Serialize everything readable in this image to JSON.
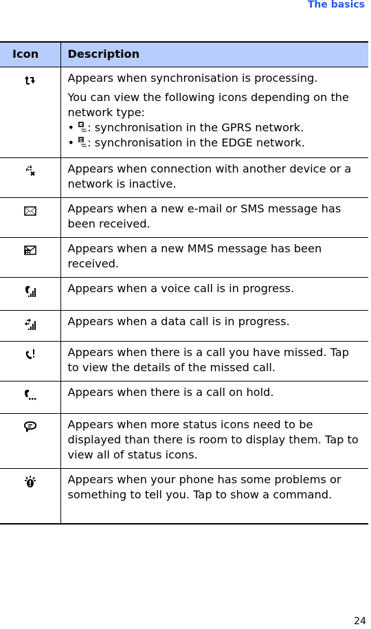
{
  "header": {
    "section_title": "The basics"
  },
  "table": {
    "columns": [
      "Icon",
      "Description"
    ],
    "rows": [
      {
        "icon": "sync-icon",
        "paragraphs": [
          "Appears when synchronisation is processing.",
          "You can view the following icons depending on the network type:"
        ],
        "bullets": [
          {
            "icon": "gprs-sync-icon",
            "text": ": synchronisation in the GPRS network."
          },
          {
            "icon": "edge-sync-icon",
            "text": ": synchronisation in the EDGE network."
          }
        ]
      },
      {
        "icon": "connection-inactive-icon",
        "paragraphs": [
          "Appears when connection with another device or a network is inactive."
        ]
      },
      {
        "icon": "envelope-icon",
        "paragraphs": [
          "Appears when a new e-mail or SMS message has been received."
        ]
      },
      {
        "icon": "mms-envelope-icon",
        "paragraphs": [
          "Appears when a new MMS message has been received."
        ]
      },
      {
        "icon": "voice-call-icon",
        "paragraphs": [
          "Appears when a voice call is in progress."
        ]
      },
      {
        "icon": "data-call-icon",
        "paragraphs": [
          "Appears when a data call is in progress."
        ]
      },
      {
        "icon": "missed-call-icon",
        "paragraphs": [
          "Appears when there is a call you have missed. Tap to view the details of the missed call."
        ]
      },
      {
        "icon": "call-on-hold-icon",
        "paragraphs": [
          "Appears when there is a call on hold."
        ]
      },
      {
        "icon": "more-status-icons-icon",
        "paragraphs": [
          "Appears when more status icons need to be displayed than there is room to display them. Tap to view all of status icons."
        ]
      },
      {
        "icon": "notification-icon",
        "paragraphs": [
          "Appears when your phone has some problems or something to tell you. Tap to show a command."
        ]
      }
    ]
  },
  "footer": {
    "page_number": "24"
  },
  "colors": {
    "title": "#1f5cf0",
    "header_bg": "#b7cdfb"
  }
}
